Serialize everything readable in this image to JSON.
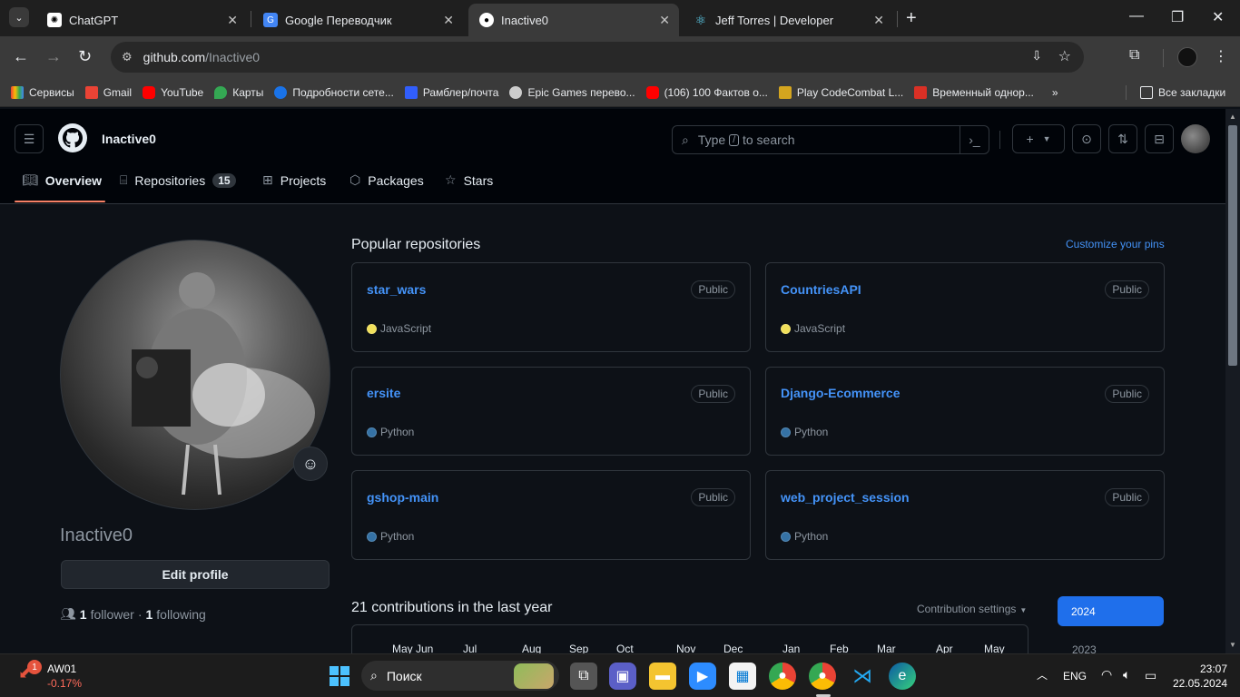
{
  "browser": {
    "tabs": [
      {
        "title": "ChatGPT",
        "active": false
      },
      {
        "title": "Google Переводчик",
        "active": false
      },
      {
        "title": "Inactive0",
        "active": true
      },
      {
        "title": "Jeff Torres | Developer",
        "active": false
      }
    ],
    "url_host": "github.com",
    "url_path": "/Inactive0",
    "bookmarks": [
      {
        "label": "Сервисы",
        "color": "#e8453c"
      },
      {
        "label": "Gmail",
        "color": "#ea4335"
      },
      {
        "label": "YouTube",
        "color": "#ff0000"
      },
      {
        "label": "Карты",
        "color": "#34a853"
      },
      {
        "label": "Подробности сете...",
        "color": "#1a73e8"
      },
      {
        "label": "Рамблер/почта",
        "color": "#315efb"
      },
      {
        "label": "Epic Games перево...",
        "color": "#cccccc"
      },
      {
        "label": "(106) 100 Фактов о...",
        "color": "#ff0000"
      },
      {
        "label": "Play CodeCombat L...",
        "color": "#d4a51f"
      },
      {
        "label": "Временный однор...",
        "color": "#d93025"
      }
    ],
    "all_bookmarks": "Все закладки"
  },
  "github": {
    "username": "Inactive0",
    "search_before": "Type",
    "search_key": "/",
    "search_after": "to search",
    "nav": [
      {
        "label": "Overview",
        "active": true
      },
      {
        "label": "Repositories",
        "count": "15"
      },
      {
        "label": "Projects"
      },
      {
        "label": "Packages"
      },
      {
        "label": "Stars"
      }
    ],
    "profile": {
      "display_name": "Inactive0",
      "edit_button": "Edit profile",
      "followers_count": "1",
      "followers_label": "follower",
      "separator": "·",
      "following_count": "1",
      "following_label": "following"
    },
    "popular_title": "Popular repositories",
    "customize_pins": "Customize your pins",
    "repos": [
      {
        "name": "star_wars",
        "visibility": "Public",
        "language": "JavaScript",
        "lang_color": "#f1e05a"
      },
      {
        "name": "CountriesAPI",
        "visibility": "Public",
        "language": "JavaScript",
        "lang_color": "#f1e05a"
      },
      {
        "name": "ersite",
        "visibility": "Public",
        "language": "Python",
        "lang_color": "#3572A5"
      },
      {
        "name": "Django-Ecommerce",
        "visibility": "Public",
        "language": "Python",
        "lang_color": "#3572A5"
      },
      {
        "name": "gshop-main",
        "visibility": "Public",
        "language": "Python",
        "lang_color": "#3572A5"
      },
      {
        "name": "web_project_session",
        "visibility": "Public",
        "language": "Python",
        "lang_color": "#3572A5"
      }
    ],
    "contributions_title": "21 contributions in the last year",
    "contribution_settings": "Contribution settings",
    "months": [
      "May Jun",
      "Jul",
      "Aug",
      "Sep",
      "Oct",
      "Nov",
      "Dec",
      "Jan",
      "Feb",
      "Mar",
      "Apr",
      "May"
    ],
    "years": [
      "2024",
      "2023"
    ]
  },
  "taskbar": {
    "stock_name": "AW01",
    "stock_change": "-0.17%",
    "notification_count": "1",
    "search_label": "Поиск",
    "lang": "ENG",
    "time": "23:07",
    "date": "22.05.2024"
  },
  "colors": {
    "link": "#4493f8",
    "accent_underline": "#f78166",
    "year_active": "#1f6feb"
  }
}
